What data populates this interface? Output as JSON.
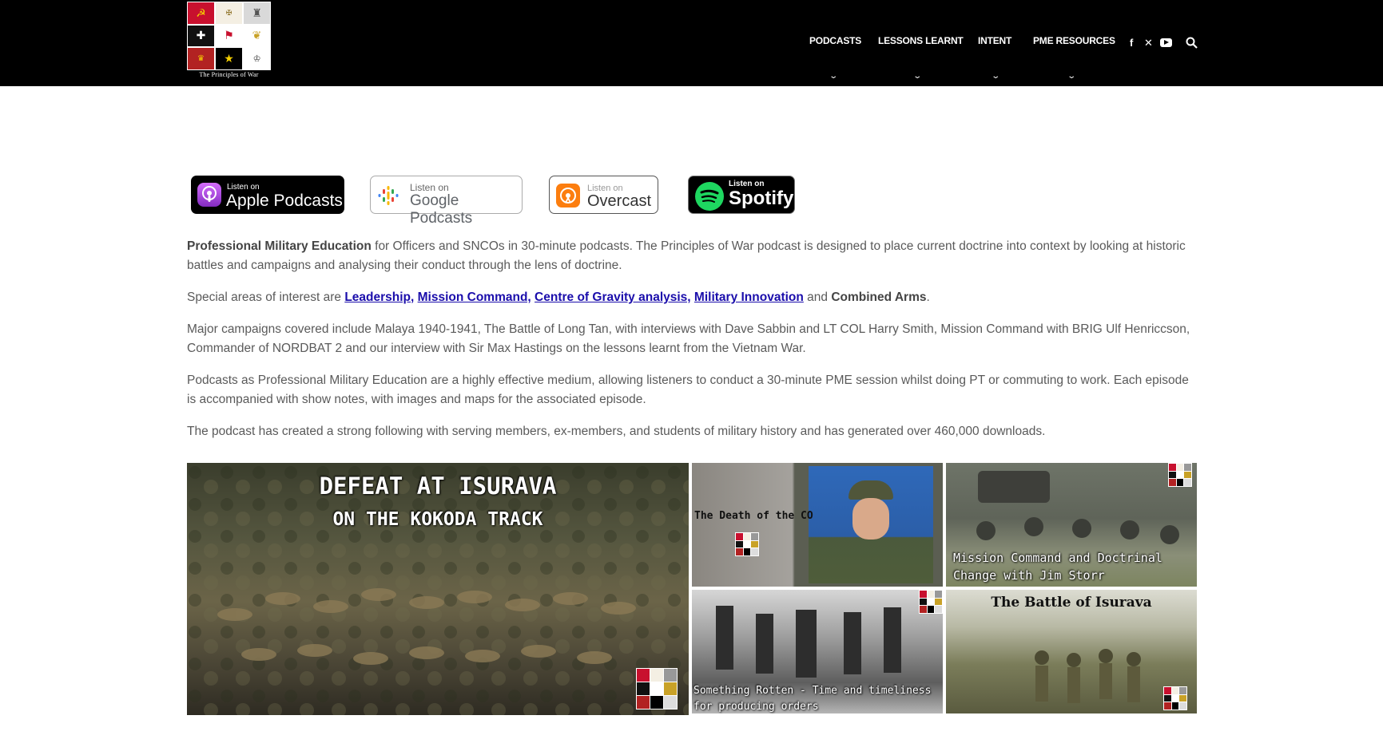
{
  "site": {
    "logo_caption": "The Principles of War"
  },
  "nav": {
    "items": [
      {
        "label": "PODCASTS"
      },
      {
        "label": "LESSONS LEARNT"
      },
      {
        "label": "INTENT"
      },
      {
        "label": "PME RESOURCES"
      }
    ],
    "caret": "⌄",
    "social": [
      "facebook-icon",
      "x-icon",
      "youtube-icon",
      "search-icon"
    ]
  },
  "badges": {
    "apple": {
      "small": "Listen on",
      "large": "Apple Podcasts"
    },
    "google": {
      "small": "Listen on",
      "large": "Google Podcasts"
    },
    "overcast": {
      "small": "Listen on",
      "large": "Overcast"
    },
    "spotify": {
      "small": "Listen on",
      "large": "Spotify"
    }
  },
  "content": {
    "p1_bold": "Professional Military Education",
    "p1_rest": " for Officers and SNCOs in 30-minute podcasts.  The Principles of War podcast is designed to place current doctrine into context by looking at historic battles and campaigns and analysing their conduct through the lens of doctrine.",
    "p2_intro": "Special areas of interest are ",
    "p2_links": [
      "Leadership,",
      "Mission Command,",
      "Centre of Gravity analysis,",
      "Military Innovation"
    ],
    "p2_and": " and ",
    "p2_bold": "Combined Arms",
    "p2_end": ".",
    "p3": "Major campaigns covered include Malaya 1940-1941, The Battle of Long Tan, with interviews with Dave Sabbin and LT COL Harry Smith, Mission Command with BRIG Ulf Henriccson, Commander of NORDBAT 2 and our interview with Sir Max Hastings on the lessons learnt from the Vietnam War.",
    "p4": "Podcasts as Professional Military Education are a highly effective medium, allowing listeners to conduct a 30-minute PME session whilst doing PT or commuting to work.  Each episode is accompanied with show notes, with images and maps for the associated episode.",
    "p5": "The podcast has created a strong following with serving members, ex-members, and students of military history and has generated over 460,000 downloads."
  },
  "gallery": {
    "main_title_1": "DEFEAT AT ISURAVA",
    "main_title_2": "ON THE KOKODA TRACK",
    "death_co": "The Death of the CO",
    "mission_command_1": "Mission Command and Doctrinal",
    "mission_command_2": "Change with Jim Storr",
    "something_rotten_1": "Something Rotten - Time and timeliness",
    "something_rotten_2": "for producing orders",
    "battle_isurava": "The Battle of Isurava"
  },
  "colors": {
    "header_bg": "#000000",
    "link": "#1a0dab",
    "spotify_green": "#1ed760",
    "overcast_orange": "#fc7e0f"
  }
}
